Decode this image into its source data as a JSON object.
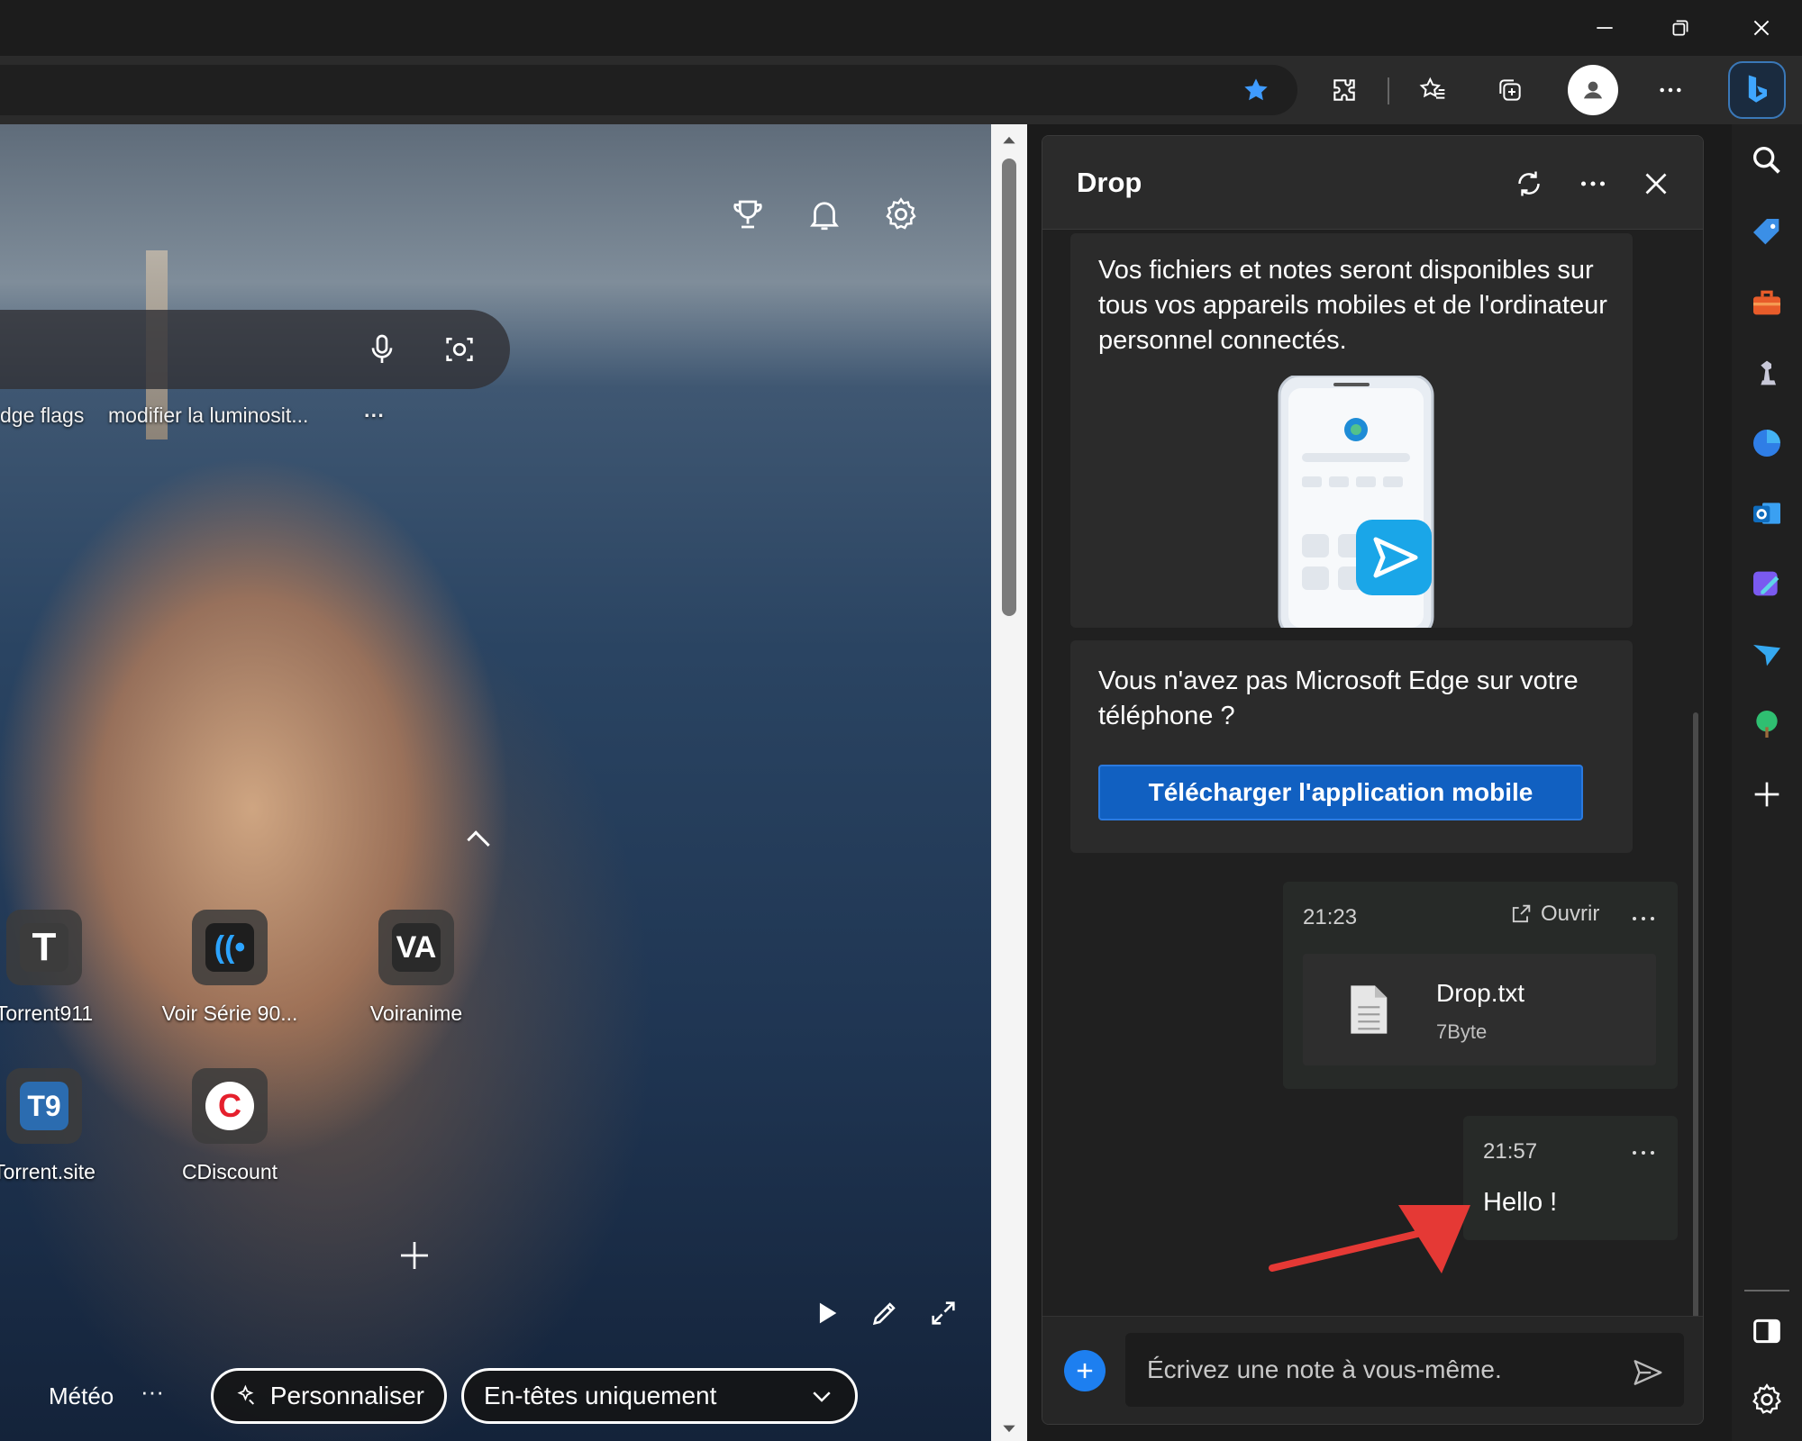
{
  "window": {
    "minimize": "minimize",
    "restore": "restore",
    "close": "close"
  },
  "toolbar": {
    "icons": [
      "favorite-star-icon",
      "extensions-icon",
      "favorites-icon",
      "collections-icon",
      "profile-icon",
      "more-icon",
      "bing-copilot-icon"
    ]
  },
  "newtab": {
    "quick_links": [
      "dge flags",
      "modifier la luminosit...",
      "···"
    ],
    "tiles": [
      {
        "label": "Torrent911",
        "glyph": "T"
      },
      {
        "label": "Voir Série 90...",
        "glyph": "((•"
      },
      {
        "label": "Voiranime",
        "glyph": "VA"
      },
      {
        "label": "Torrent.site",
        "glyph": "T9"
      },
      {
        "label": "CDiscount",
        "glyph": "C"
      }
    ],
    "bottom_nav": {
      "weather": "Météo",
      "more": "···"
    },
    "personalize": "Personnaliser",
    "layout_select": "En-têtes uniquement"
  },
  "drop": {
    "title": "Drop",
    "info_text": "Vos fichiers et notes seront disponibles sur tous vos appareils mobiles et de l'ordinateur personnel connectés.",
    "no_edge_text": "Vous n'avez pas Microsoft Edge sur votre téléphone ?",
    "download_button": "Télécharger l'application mobile",
    "messages": [
      {
        "time": "21:23",
        "open_label": "Ouvrir",
        "file_name": "Drop.txt",
        "file_size": "7Byte"
      },
      {
        "time": "21:57",
        "text": "Hello !"
      }
    ],
    "composer_placeholder": "Écrivez une note à vous-même."
  },
  "colors": {
    "accent": "#1160c1",
    "plus_button": "#1d7ff0",
    "arrow": "#e53935"
  }
}
